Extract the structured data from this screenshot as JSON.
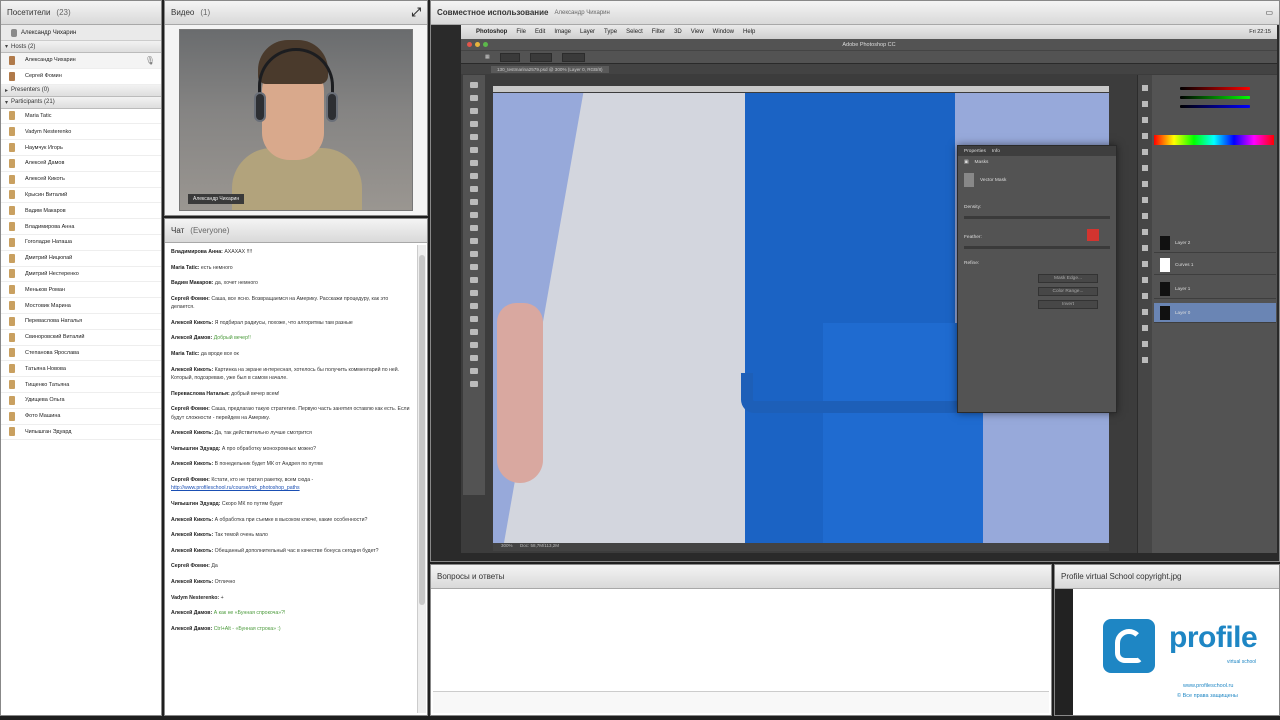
{
  "attendees": {
    "title": "Посетители",
    "count": "(23)",
    "me": "Александр Чихарин",
    "hosts_section": "Hosts (2)",
    "hosts": [
      "Александр Чихарин",
      "Сергей Фомин"
    ],
    "presenters_section": "Presenters (0)",
    "participants_section": "Participants (21)",
    "participants": [
      "Maria Tatic",
      "Vadym Nesterenko",
      "Наумчук Игорь",
      "Алексей Дамов",
      "Алексей Кикоть",
      "Крысин Виталий",
      "Вадим Макаров",
      "Владимирова Анна",
      "Гоголадзе Наташа",
      "Дмитрий Ницюпай",
      "Дмитрий Нестеренко",
      "Меньков Роман",
      "Мостовик Марина",
      "Переваслова Наталья",
      "Свиноровский Виталий",
      "Степанова Ярослава",
      "Татьяна Новова",
      "Тищенко Татьяна",
      "Удищева Ольга",
      "Фото Машина",
      "Чипышган Эдуард"
    ]
  },
  "video": {
    "title": "Видео",
    "count": "(1)",
    "speaker_label": "Александр Чихарин"
  },
  "chat": {
    "title": "Чат",
    "subtitle": "(Everyone)",
    "messages": [
      {
        "author": "Владимирова Анна:",
        "text": "АХАХАХ !!!!",
        "style": "normal"
      },
      {
        "author": "Maria Tatic:",
        "text": "есть немного",
        "style": "normal"
      },
      {
        "author": "Вадим Макаров:",
        "text": "да, хочет немного",
        "style": "normal"
      },
      {
        "author": "Сергей Фомин:",
        "text": "Саша, все ясно. Возвращаемся на Америку. Расскажи процедуру, как это делается.",
        "style": "normal"
      },
      {
        "author": "Алексей Кикоть:",
        "text": "Я подбирал радиусы, похоже, что алгоритмы там разные",
        "style": "normal"
      },
      {
        "author": "Алексей Дамов:",
        "text": "Добрый вечер!!",
        "style": "green"
      },
      {
        "author": "Maria Tatic:",
        "text": "да вроде все ок",
        "style": "normal"
      },
      {
        "author": "Алексей Кикоть:",
        "text": "Картинка на экране интересная, хотелось бы получить комментарий по ней. Который, подозреваю, уже был в самом начале.",
        "style": "normal"
      },
      {
        "author": "Переваслова Наталья:",
        "text": "добрый вечер всем!",
        "style": "normal"
      },
      {
        "author": "Сергей Фомин:",
        "text": "Саша, предлагаю такую стратегию. Первую часть занятия оставлю как есть. Если будут сложности - перейдем на Америку.",
        "style": "normal"
      },
      {
        "author": "Алексей Кикоть:",
        "text": "Да, так действительно лучше смотрится",
        "style": "normal"
      },
      {
        "author": "Чипышгин Эдуард:",
        "text": "А про обработку монохромных можно?",
        "style": "normal"
      },
      {
        "author": "Алексей Кикоть:",
        "text": "В понедельник будет МК от Андрея по путям",
        "style": "normal"
      },
      {
        "author": "Сергей Фомин:",
        "text": "Кстати, кто не тратил ракетку, всем сюда -",
        "link": "http://www.profileschool.ru/course/mk_photoshop_paths",
        "style": "link"
      },
      {
        "author": "Чипышгин Эдуард:",
        "text": "Скоро МК по путям будет",
        "style": "normal"
      },
      {
        "author": "Алексей Кикоть:",
        "text": "А обработка при съемке в высоком ключе, какие особенности?",
        "style": "normal"
      },
      {
        "author": "Алексей Кикоть:",
        "text": "Так темой очень мало",
        "style": "normal"
      },
      {
        "author": "Алексей Кикоть:",
        "text": "Обещанный дополнительный час в качестве бонуса сегодня будет?",
        "style": "normal"
      },
      {
        "author": "Сергей Фомин:",
        "text": "Да",
        "style": "normal"
      },
      {
        "author": "Алексей Кикоть:",
        "text": "Отлично",
        "style": "normal"
      },
      {
        "author": "Vadym Nesterenko:",
        "text": "+",
        "style": "normal"
      },
      {
        "author": "Алексей Дамов:",
        "text": "А как не «Бунная спрокоча»?!",
        "style": "green"
      },
      {
        "author": "Алексей Дамов:",
        "text": "Ctrl+Alt - «Бунная строка» :)",
        "style": "green"
      }
    ]
  },
  "share": {
    "title": "Совместное использование",
    "presenter": "Александр Чихарин",
    "mac_menu": [
      "Photoshop",
      "File",
      "Edit",
      "Image",
      "Layer",
      "Type",
      "Select",
      "Filter",
      "3D",
      "View",
      "Window",
      "Help"
    ],
    "mac_clock": "Fri 22:15",
    "app_title": "Adobe Photoshop CC",
    "doc_tab": "130_testmarina2579.psd @ 300% (Layer 0, RGB/8)",
    "zoom": "300%",
    "doc_info": "Doc: 58,7M/113,2M",
    "props_title": "Properties",
    "props_tab2": "Info",
    "props_section": "Masks",
    "props_mask": "Vector Mask",
    "props_density": "Density:",
    "props_feather": "Feather:",
    "props_refine": "Refine:",
    "props_buttons": [
      "Mask Edge...",
      "Color Range...",
      "Invert"
    ],
    "layers": [
      "Layer 2",
      "Curves 1",
      "Layer 1",
      "Layer 0"
    ]
  },
  "qa": {
    "title": "Вопросы и ответы"
  },
  "logo_panel": {
    "title": "Profile virtual School copyright.jpg",
    "brand": "profile",
    "subtitle": "virtual school",
    "url": "www.profileschool.ru",
    "rights": "© Все права защищены"
  },
  "colors": {
    "accent": "#1e86c4",
    "chat_green": "#4a9a3a",
    "ps_dark": "#535353",
    "fabric_blue": "#1b63c4"
  }
}
